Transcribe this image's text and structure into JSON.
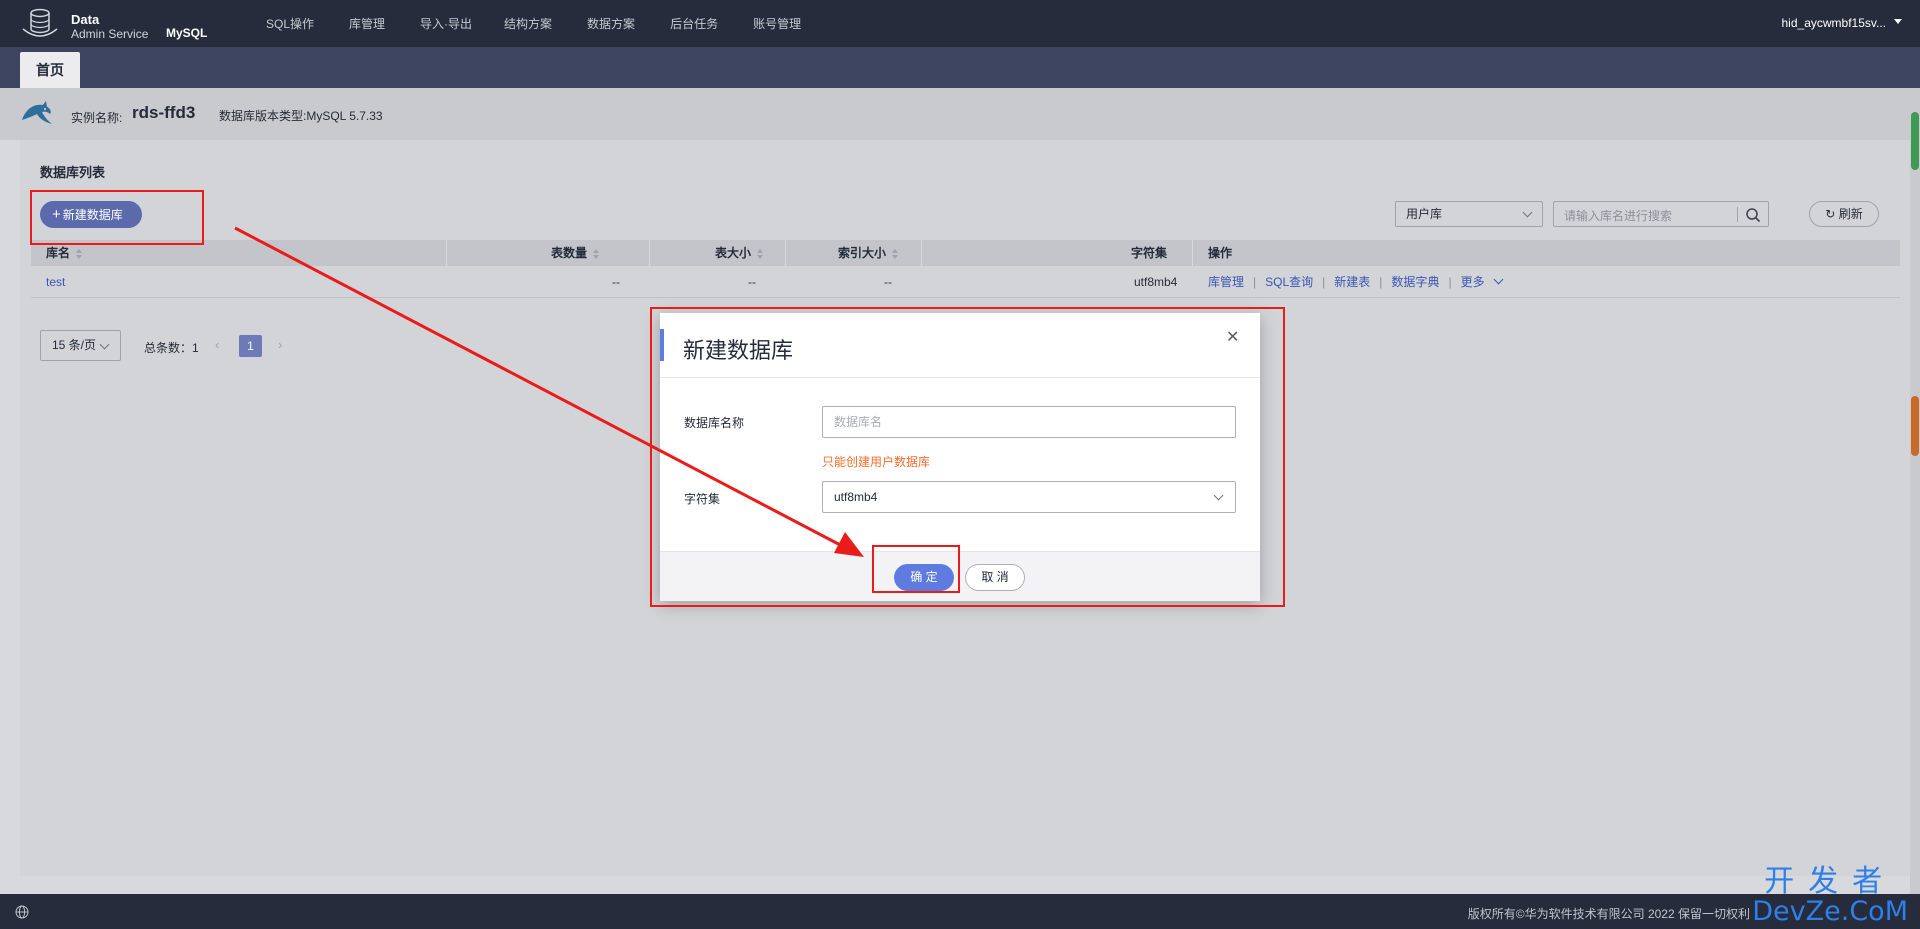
{
  "header": {
    "brand_title": "Data",
    "brand_subtitle": "Admin Service",
    "db_engine": "MySQL",
    "nav": [
      "SQL操作",
      "库管理",
      "导入·导出",
      "结构方案",
      "数据方案",
      "后台任务",
      "账号管理"
    ],
    "user": "hid_aycwmbf15sv..."
  },
  "tabs": {
    "home": "首页"
  },
  "instance": {
    "label": "实例名称:",
    "name": "rds-ffd3",
    "version_label": "数据库版本类型:",
    "version": "MySQL 5.7.33"
  },
  "db_list": {
    "title": "数据库列表",
    "new_button": "新建数据库",
    "filter": "用户库",
    "search_placeholder": "请输入库名进行搜索",
    "refresh": "刷新",
    "columns": [
      "库名",
      "表数量",
      "表大小",
      "索引大小",
      "字符集",
      "操作"
    ],
    "rows": [
      {
        "name": "test",
        "tables": "--",
        "table_size": "--",
        "index_size": "--",
        "charset": "utf8mb4"
      }
    ],
    "actions": [
      "库管理",
      "SQL查询",
      "新建表",
      "数据字典",
      "更多"
    ]
  },
  "pager": {
    "page_size": "15 条/页",
    "total": "总条数：1",
    "current": "1"
  },
  "dialog": {
    "title": "新建数据库",
    "name_label": "数据库名称",
    "name_placeholder": "数据库名",
    "hint": "只能创建用户数据库",
    "charset_label": "字符集",
    "charset_value": "utf8mb4",
    "ok": "确 定",
    "cancel": "取 消"
  },
  "footer": {
    "copyright": "版权所有©华为软件技术有限公司 2022 保留一切权利"
  },
  "watermark": {
    "line1": "开发者",
    "line2": "DevZe.CoM"
  },
  "colors": {
    "annotation": "#ea1b1b",
    "primary": "#5e7ce0",
    "topbar": "#262c3c",
    "warning": "#f66f2c"
  }
}
